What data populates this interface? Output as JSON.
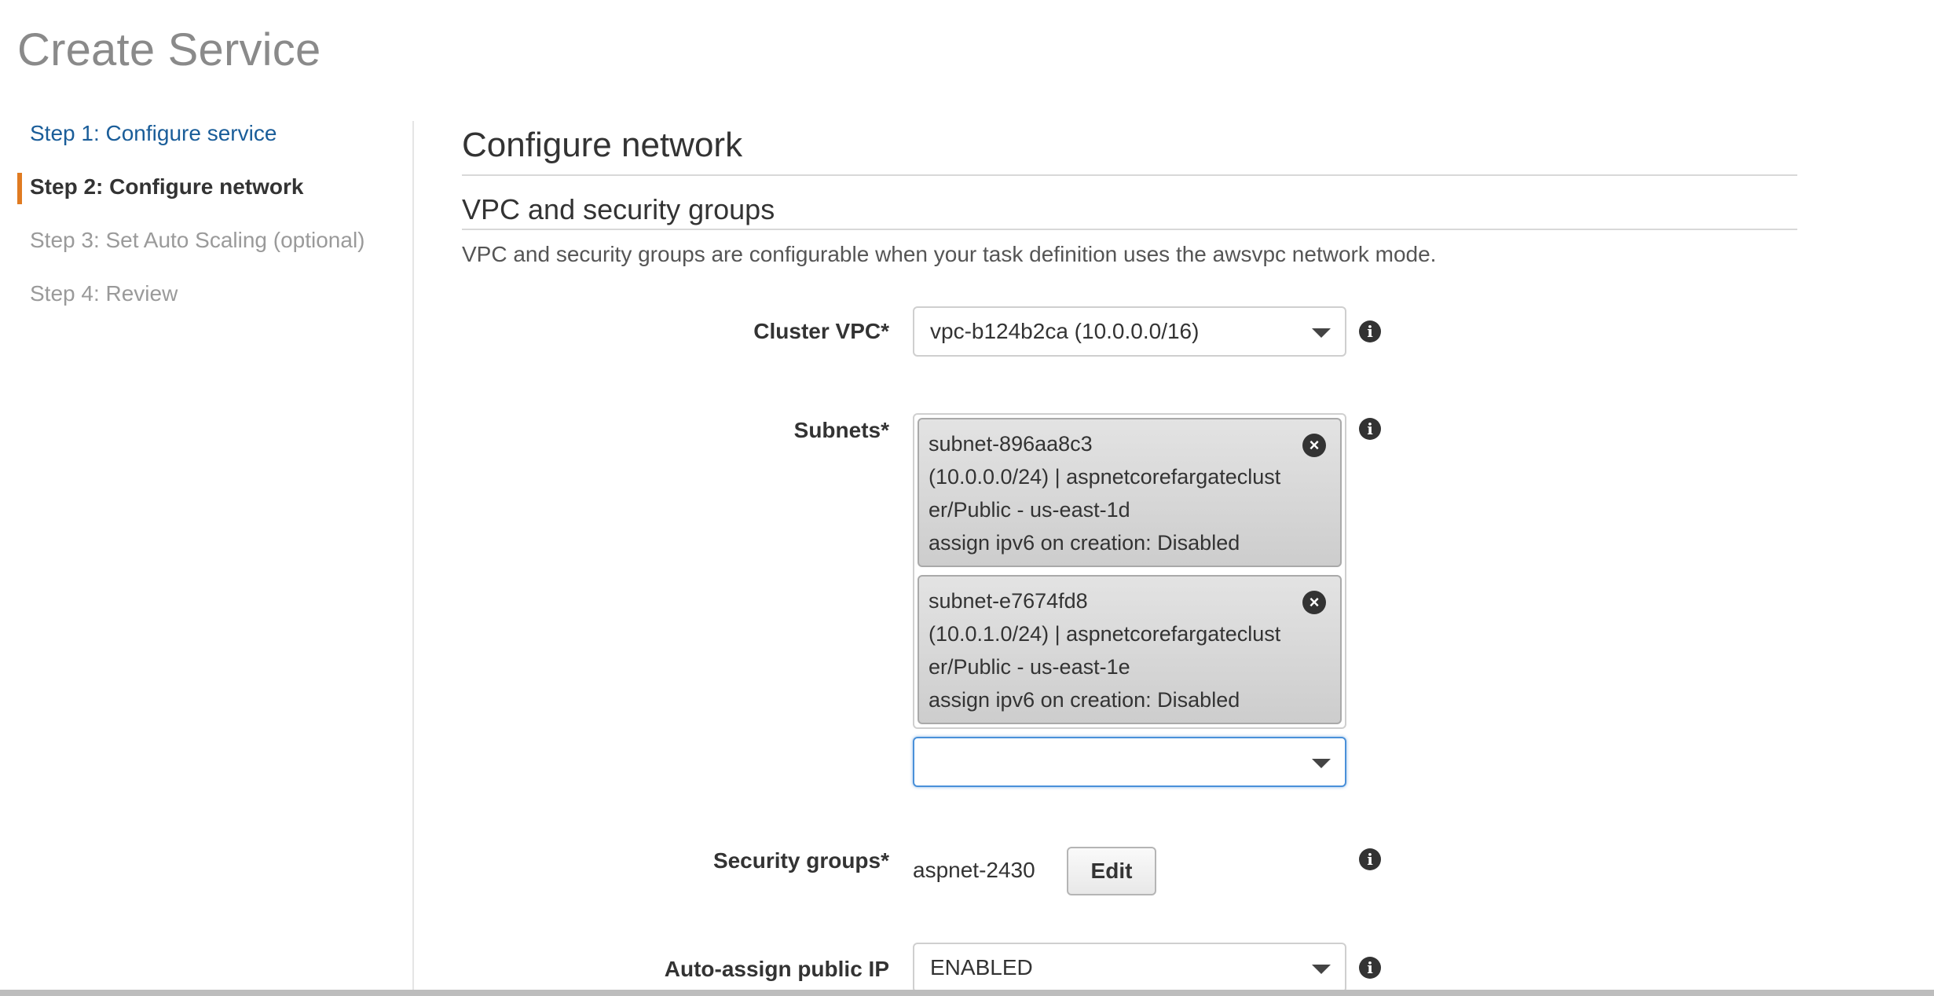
{
  "page": {
    "title": "Create Service"
  },
  "steps": [
    {
      "label": "Step 1: Configure service",
      "state": "link"
    },
    {
      "label": "Step 2: Configure network",
      "state": "active"
    },
    {
      "label": "Step 3: Set Auto Scaling (optional)",
      "state": "disabled"
    },
    {
      "label": "Step 4: Review",
      "state": "disabled"
    }
  ],
  "main": {
    "section_title": "Configure network",
    "subsection_title": "VPC and security groups",
    "description": "VPC and security groups are configurable when your task definition uses the awsvpc network mode."
  },
  "form": {
    "cluster_vpc": {
      "label": "Cluster VPC*",
      "value": "vpc-b124b2ca (10.0.0.0/16)"
    },
    "subnets": {
      "label": "Subnets*",
      "selected": [
        {
          "lines": [
            "subnet-896aa8c3",
            "(10.0.0.0/24) | aspnetcorefargateclust",
            "er/Public - us-east-1d",
            "assign ipv6 on creation: Disabled"
          ]
        },
        {
          "lines": [
            "subnet-e7674fd8",
            "(10.0.1.0/24) | aspnetcorefargateclust",
            "er/Public - us-east-1e",
            "assign ipv6 on creation: Disabled"
          ]
        }
      ],
      "add_value": ""
    },
    "security_groups": {
      "label": "Security groups*",
      "value": "aspnet-2430",
      "edit_label": "Edit"
    },
    "auto_assign_ip": {
      "label": "Auto-assign public IP",
      "value": "ENABLED"
    }
  },
  "icons": {
    "info": "info-icon",
    "remove": "remove-tag-icon",
    "caret": "chevron-down-icon"
  },
  "colors": {
    "accent": "#e07b21",
    "link": "#1a5d99",
    "focus": "#4a90d9"
  }
}
